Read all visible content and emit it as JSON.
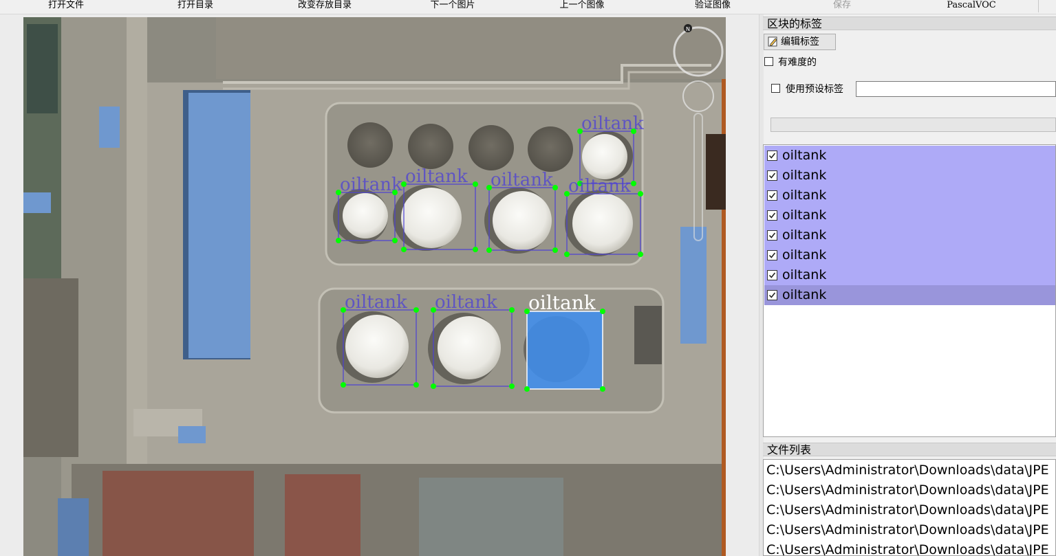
{
  "toolbar": {
    "open_file": "打开文件",
    "open_dir": "打开目录",
    "change_save_dir": "改变存放目录",
    "next_image": "下一个图片",
    "prev_image": "上一个图像",
    "verify_image": "验证图像",
    "save": "保存",
    "format": "PascalVOC"
  },
  "canvas": {
    "box_label_text": "oiltank",
    "colors": {
      "box_line": "#4c40d4",
      "vertex": "#00ff00",
      "selected_fill": "#3d8ef0",
      "selected_text": "#ffffff"
    }
  },
  "box_labels_dock": {
    "title": "区块的标签",
    "edit_label_button": "编辑标签",
    "difficult_label": "有难度的",
    "use_default_label": "使用预设标签",
    "default_label_value": "",
    "items": [
      {
        "label": "oiltank",
        "checked": true
      },
      {
        "label": "oiltank",
        "checked": true
      },
      {
        "label": "oiltank",
        "checked": true
      },
      {
        "label": "oiltank",
        "checked": true
      },
      {
        "label": "oiltank",
        "checked": true
      },
      {
        "label": "oiltank",
        "checked": true
      },
      {
        "label": "oiltank",
        "checked": true
      },
      {
        "label": "oiltank",
        "checked": true,
        "selected": true
      }
    ],
    "colors": {
      "item_bg": "#aeaaf7",
      "selected_bg": "#9995db"
    }
  },
  "file_list_dock": {
    "title": "文件列表",
    "files": [
      "C:\\Users\\Administrator\\Downloads\\data\\JPE",
      "C:\\Users\\Administrator\\Downloads\\data\\JPE",
      "C:\\Users\\Administrator\\Downloads\\data\\JPE",
      "C:\\Users\\Administrator\\Downloads\\data\\JPE",
      "C:\\Users\\Administrator\\Downloads\\data\\JPE"
    ]
  }
}
